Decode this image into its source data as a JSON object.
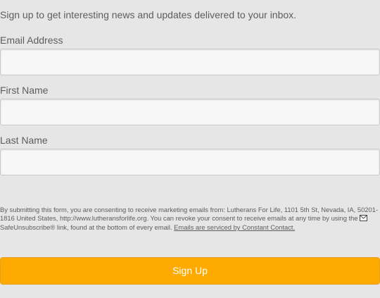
{
  "intro": {
    "text": "Sign up to get interesting news and updates delivered to your inbox."
  },
  "fields": {
    "email": {
      "label": "Email Address",
      "value": "",
      "placeholder": ""
    },
    "first_name": {
      "label": "First Name",
      "value": "",
      "placeholder": ""
    },
    "last_name": {
      "label": "Last Name",
      "value": "",
      "placeholder": ""
    }
  },
  "consent": {
    "text_before": "By submitting this form, you are consenting to receive marketing emails from: Lutherans For Life, 1101 5th St, Nevada, IA, 50201-1816 United States, http://www.lutheransforlife.org. You can revoke your consent to receive emails at any time by using the",
    "icon": "envelope-icon",
    "safeunsubscribe": "SafeUnsubscribe®",
    "text_after": "link, found at the bottom of every email.",
    "link_text": "Emails are serviced by Constant Contact."
  },
  "button": {
    "label": "Sign Up"
  },
  "colors": {
    "background": "#e6e6e6",
    "button": "#ffaa00",
    "input_background": "#f7f7f7",
    "text": "#5d5d5d"
  }
}
